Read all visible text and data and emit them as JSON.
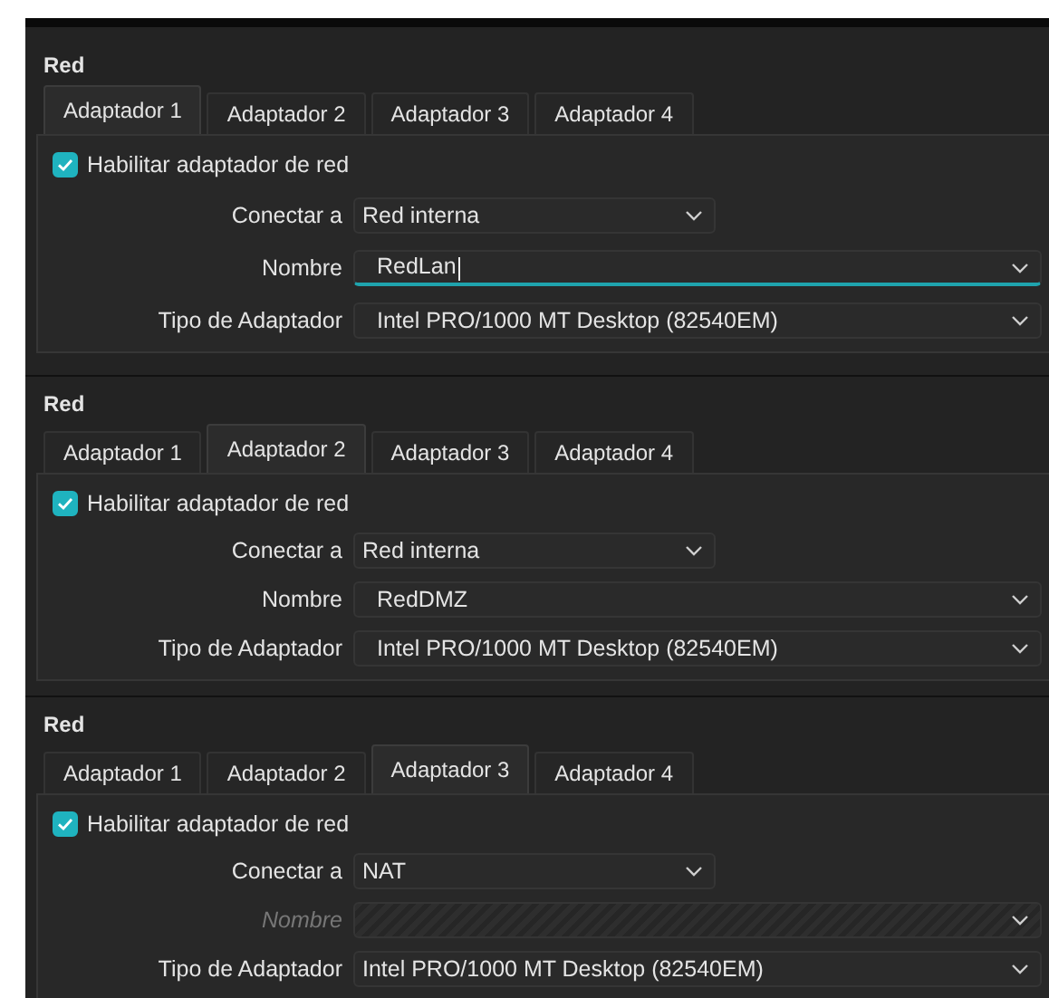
{
  "panels": [
    {
      "title": "Red",
      "tabs": [
        {
          "label": "Adaptador 1",
          "selected": true
        },
        {
          "label": "Adaptador 2",
          "selected": false
        },
        {
          "label": "Adaptador 3",
          "selected": false
        },
        {
          "label": "Adaptador 4",
          "selected": false
        }
      ],
      "enable": {
        "label": "Habilitar adaptador de red",
        "checked": true
      },
      "fields": [
        {
          "label": "Conectar a",
          "value": "Red interna",
          "kind": "short",
          "disabled": false,
          "focused": false
        },
        {
          "label": "Nombre",
          "value": "RedLan",
          "kind": "wide",
          "disabled": false,
          "focused": true
        },
        {
          "label": "Tipo de Adaptador",
          "value": "Intel PRO/1000 MT Desktop (82540EM)",
          "kind": "wide",
          "disabled": false,
          "focused": false
        }
      ]
    },
    {
      "title": "Red",
      "tabs": [
        {
          "label": "Adaptador 1",
          "selected": false
        },
        {
          "label": "Adaptador 2",
          "selected": true
        },
        {
          "label": "Adaptador 3",
          "selected": false
        },
        {
          "label": "Adaptador 4",
          "selected": false
        }
      ],
      "enable": {
        "label": "Habilitar adaptador de red",
        "checked": true
      },
      "fields": [
        {
          "label": "Conectar a",
          "value": "Red interna",
          "kind": "short",
          "disabled": false,
          "focused": false
        },
        {
          "label": "Nombre",
          "value": "RedDMZ",
          "kind": "wide",
          "disabled": false,
          "focused": false
        },
        {
          "label": "Tipo de Adaptador",
          "value": "Intel PRO/1000 MT Desktop (82540EM)",
          "kind": "wide",
          "disabled": false,
          "focused": false
        }
      ]
    },
    {
      "title": "Red",
      "tabs": [
        {
          "label": "Adaptador 1",
          "selected": false
        },
        {
          "label": "Adaptador 2",
          "selected": false
        },
        {
          "label": "Adaptador 3",
          "selected": true
        },
        {
          "label": "Adaptador 4",
          "selected": false
        }
      ],
      "enable": {
        "label": "Habilitar adaptador de red",
        "checked": true
      },
      "fields": [
        {
          "label": "Conectar a",
          "value": "NAT",
          "kind": "short",
          "disabled": false,
          "focused": false
        },
        {
          "label": "Nombre",
          "kind": "wide",
          "disabled": true,
          "focused": false
        },
        {
          "label": "Tipo de Adaptador",
          "value": "Intel PRO/1000 MT Desktop (82540EM)",
          "kind": "wide",
          "disabled": false,
          "focused": false
        }
      ]
    }
  ]
}
